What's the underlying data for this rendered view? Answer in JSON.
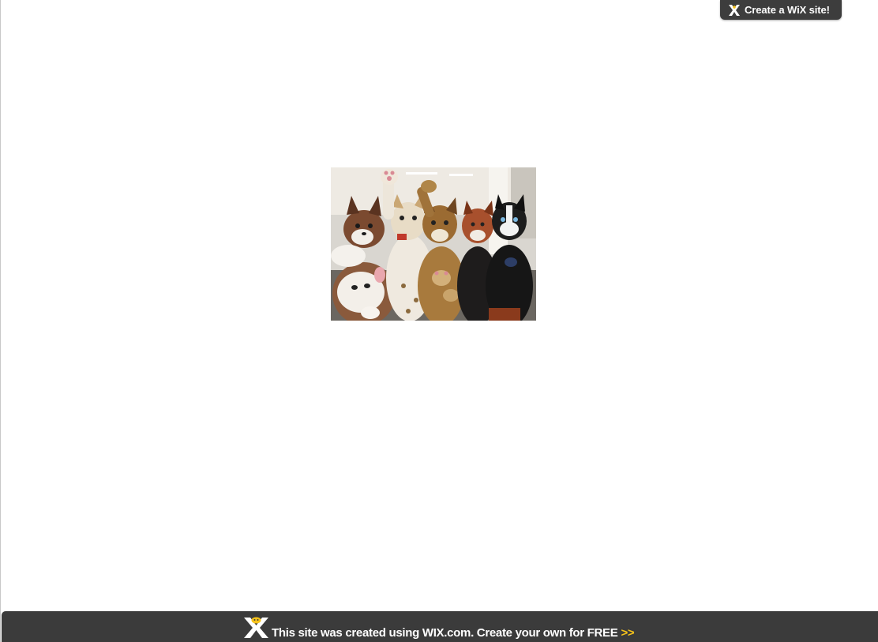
{
  "header_tab": {
    "label": "Create a WiX site!"
  },
  "main": {
    "photo_icon": "furry-group-photo"
  },
  "footer": {
    "text": "This site was created using WIX.com. Create your own for FREE",
    "arrows": ">>"
  },
  "colors": {
    "banner_bg": "#3b3b3b",
    "banner_text": "#ffffff",
    "arrow_accent": "#f7c31a",
    "page_bg": "#ffffff"
  }
}
